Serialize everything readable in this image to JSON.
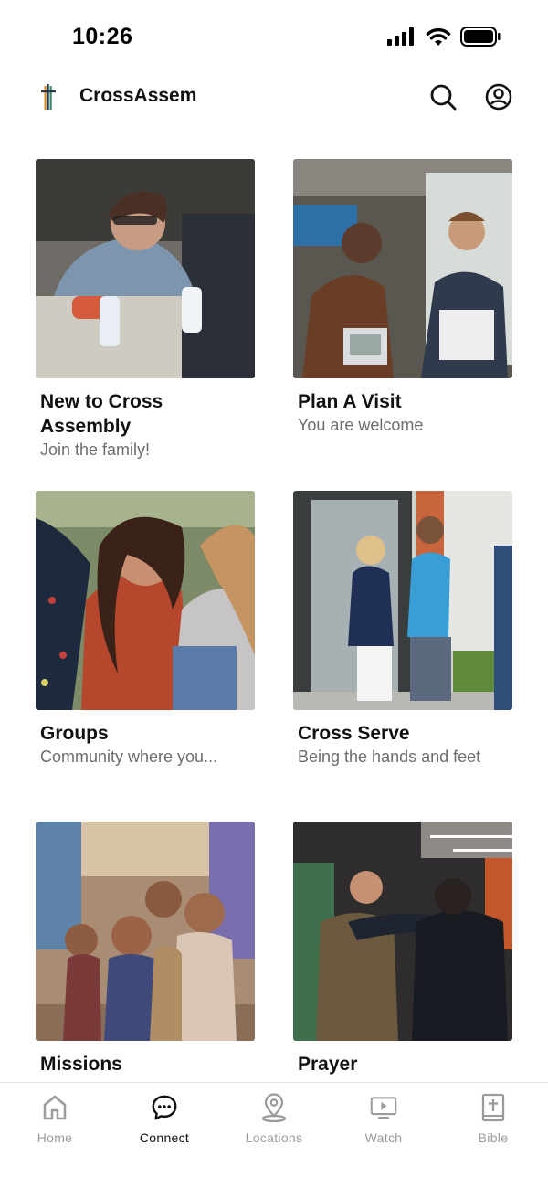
{
  "status_bar": {
    "time": "10:26"
  },
  "header": {
    "title": "CrossAssem"
  },
  "cards": [
    {
      "title": "New to Cross Assembly",
      "subtitle": "Join the family!"
    },
    {
      "title": "Plan A Visit",
      "subtitle": "You are welcome"
    },
    {
      "title": "Groups",
      "subtitle": "Community where you..."
    },
    {
      "title": "Cross Serve",
      "subtitle": "Being the hands and feet"
    },
    {
      "title": "Missions",
      "subtitle": ""
    },
    {
      "title": "Prayer",
      "subtitle": ""
    }
  ],
  "tab_bar": {
    "active": "Connect",
    "tabs": [
      {
        "label": "Home",
        "icon": "home-icon"
      },
      {
        "label": "Connect",
        "icon": "chat-icon"
      },
      {
        "label": "Locations",
        "icon": "location-pin-icon"
      },
      {
        "label": "Watch",
        "icon": "tv-play-icon"
      },
      {
        "label": "Bible",
        "icon": "bible-icon"
      }
    ]
  },
  "colors": {
    "accent": "#111111",
    "inactive": "#9b9b9b",
    "subtitle": "#6d6d6d"
  }
}
